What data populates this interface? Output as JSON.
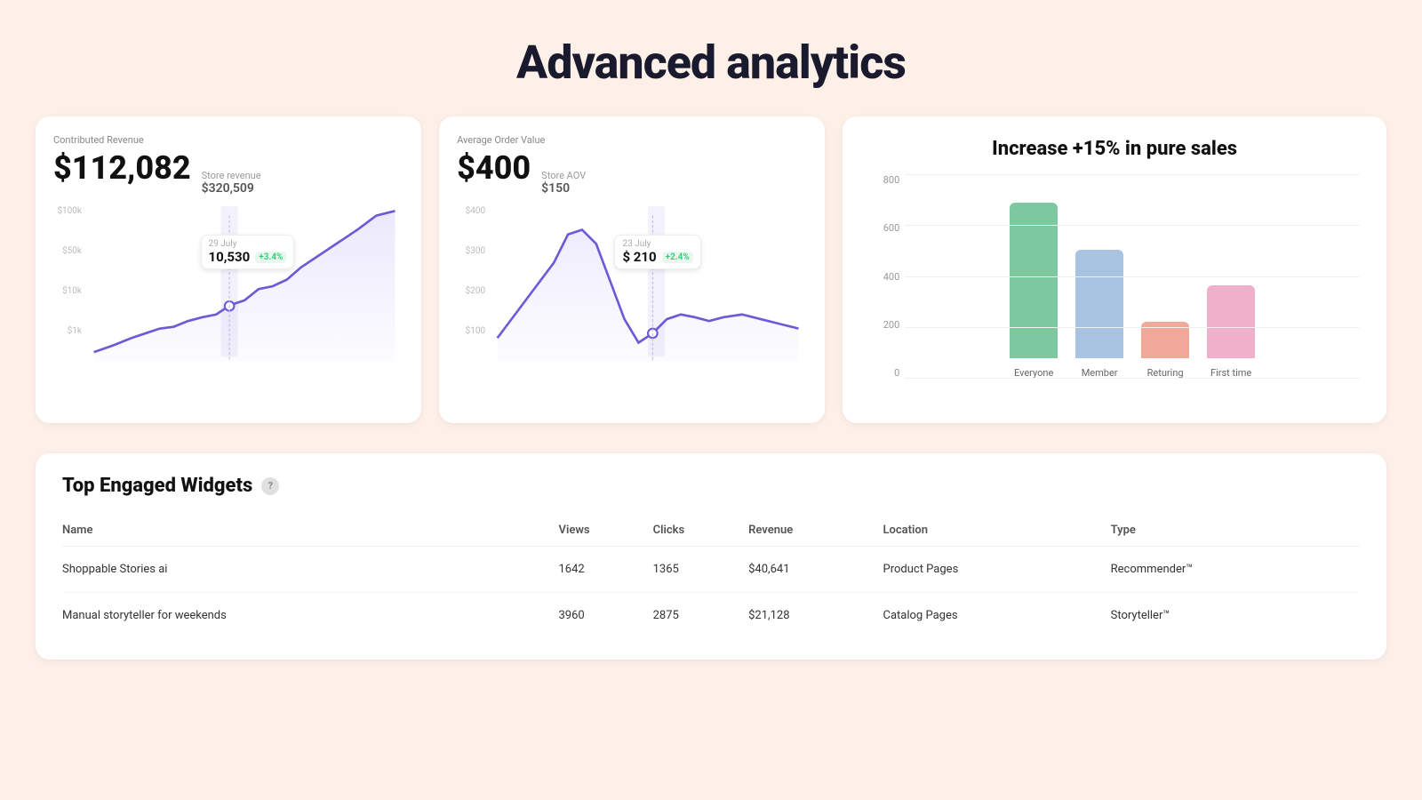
{
  "page": {
    "title": "Advanced analytics",
    "background": "#fdf0e8"
  },
  "revenue_card": {
    "label": "Contributed Revenue",
    "main_value": "$112,082",
    "sub_label": "Store revenue",
    "sub_value": "$320,509",
    "tooltip_date": "29 July",
    "tooltip_value": "10,530",
    "tooltip_badge": "+3.4%",
    "y_labels": [
      "$100k",
      "$50k",
      "$10k",
      "$1k",
      ""
    ]
  },
  "aov_card": {
    "label": "Average Order Value",
    "main_value": "$400",
    "sub_label": "Store AOV",
    "sub_value": "$150",
    "tooltip_date": "23 July",
    "tooltip_value": "$ 210",
    "tooltip_badge": "+2.4%",
    "y_labels": [
      "$400",
      "$300",
      "$200",
      "$100",
      ""
    ]
  },
  "bar_chart": {
    "title": "Increase +15% in pure sales",
    "y_labels": [
      "800",
      "600",
      "400",
      "200",
      "0"
    ],
    "bars": [
      {
        "label": "Everyone",
        "value": 700,
        "color": "#7ec8a0",
        "max": 800
      },
      {
        "label": "Member",
        "value": 490,
        "color": "#a8c4e0",
        "max": 800
      },
      {
        "label": "Returing",
        "value": 165,
        "color": "#f0a898",
        "max": 800
      },
      {
        "label": "First time",
        "value": 330,
        "color": "#f0b0cc",
        "max": 800
      }
    ]
  },
  "widgets_table": {
    "title": "Top Engaged Widgets",
    "help_tooltip": "?",
    "columns": [
      "Name",
      "Views",
      "Clicks",
      "Revenue",
      "Location",
      "Type"
    ],
    "rows": [
      {
        "name": "Shoppable Stories ai",
        "views": "1642",
        "clicks": "1365",
        "revenue": "$40,641",
        "location": "Product Pages",
        "type": "Recommender™"
      },
      {
        "name": "Manual storyteller for weekends",
        "views": "3960",
        "clicks": "2875",
        "revenue": "$21,128",
        "location": "Catalog Pages",
        "type": "Storyteller™"
      }
    ]
  }
}
